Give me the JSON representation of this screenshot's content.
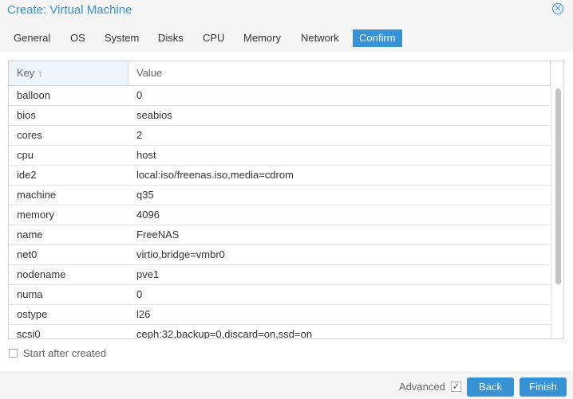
{
  "window": {
    "title": "Create: Virtual Machine"
  },
  "tabs": [
    "General",
    "OS",
    "System",
    "Disks",
    "CPU",
    "Memory",
    "Network",
    "Confirm"
  ],
  "active_tab": "Confirm",
  "grid": {
    "columns": {
      "key": "Key",
      "value": "Value"
    },
    "sort_icon": "↑",
    "rows": [
      {
        "key": "balloon",
        "value": "0"
      },
      {
        "key": "bios",
        "value": "seabios"
      },
      {
        "key": "cores",
        "value": "2"
      },
      {
        "key": "cpu",
        "value": "host"
      },
      {
        "key": "ide2",
        "value": "local:iso/freenas.iso,media=cdrom"
      },
      {
        "key": "machine",
        "value": "q35"
      },
      {
        "key": "memory",
        "value": "4096"
      },
      {
        "key": "name",
        "value": "FreeNAS"
      },
      {
        "key": "net0",
        "value": "virtio,bridge=vmbr0"
      },
      {
        "key": "nodename",
        "value": "pve1"
      },
      {
        "key": "numa",
        "value": "0"
      },
      {
        "key": "ostype",
        "value": "l26"
      },
      {
        "key": "scsi0",
        "value": "ceph:32,backup=0,discard=on,ssd=on"
      }
    ]
  },
  "start_after_created": {
    "label": "Start after created",
    "checked": false
  },
  "footer": {
    "advanced_label": "Advanced",
    "advanced_checked": true,
    "back_label": "Back",
    "finish_label": "Finish"
  },
  "colors": {
    "accent": "#3892d4",
    "chrome": "#f5f5f5"
  }
}
